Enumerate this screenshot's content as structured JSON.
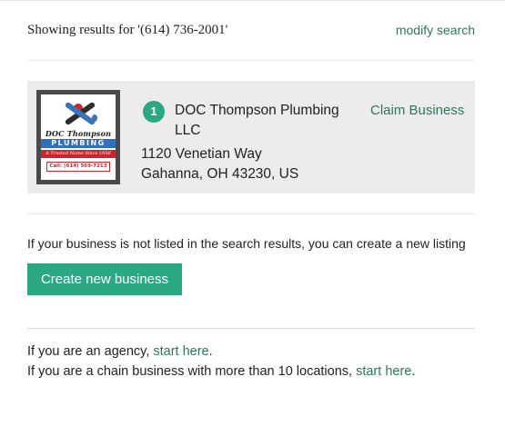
{
  "search": {
    "showing_text": "Showing results for '(614) 736-2001'",
    "modify_link": "modify search"
  },
  "result": {
    "index": "1",
    "name": "DOC Thompson Plumbing LLC",
    "claim_link": "Claim Business",
    "address_line1": "1120 Venetian Way",
    "address_line2": "Gahanna, OH 43230, US",
    "logo": {
      "name": "DOC Thompson",
      "plumbing": "PLUMBING",
      "tagline": "A Trusted Name Since 1956",
      "call": "Call: (614) 569-7213"
    }
  },
  "create": {
    "message": "If your business is not listed in the search results, you can create a new listing",
    "button_label": "Create new business"
  },
  "agency": {
    "agency_prefix": "If you are an agency, ",
    "agency_link": "start here",
    "agency_suffix": ".",
    "chain_prefix": "If you are a chain business with more than 10 locations, ",
    "chain_link": "start here",
    "chain_suffix": "."
  },
  "colors": {
    "accent": "#2ba783",
    "link": "#2a7a55",
    "card_bg": "#ececec"
  }
}
